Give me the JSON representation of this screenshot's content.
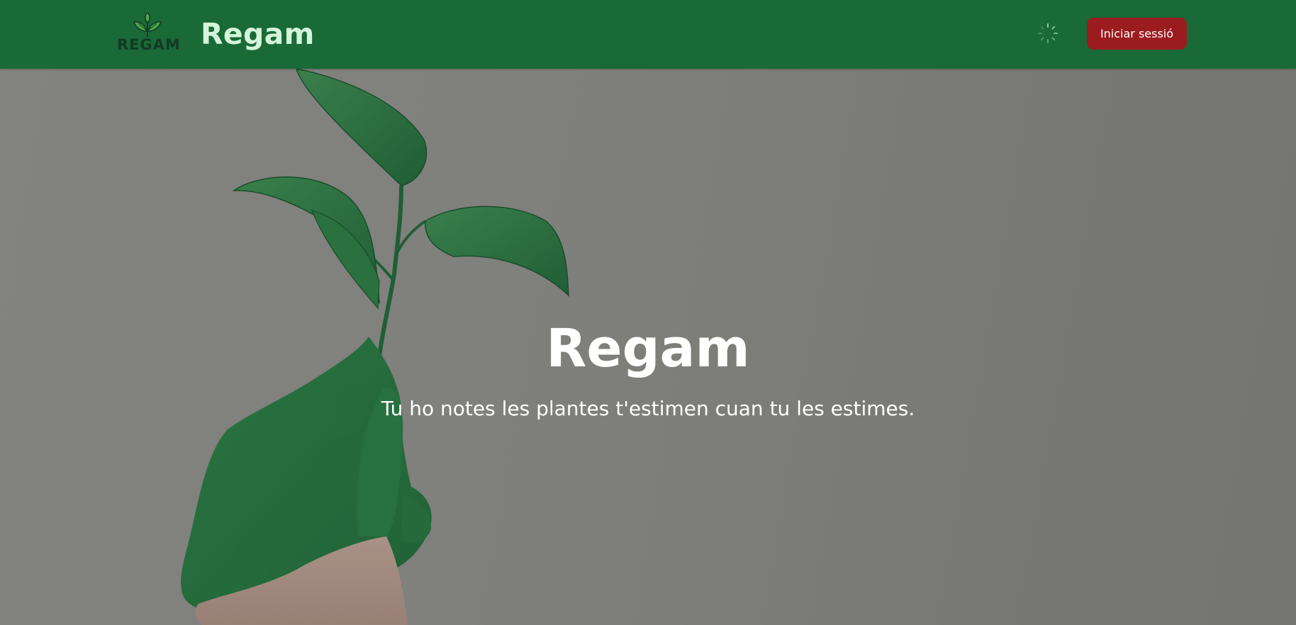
{
  "navbar": {
    "logo": {
      "icon": "sprout-leaves-icon",
      "text": "REGAM"
    },
    "brand_name": "Regam",
    "spinner_icon": "loading-spinner-icon",
    "login_label": "Iniciar sessió",
    "background_color": "#196a37",
    "login_color": "#9b1c1f"
  },
  "hero": {
    "title": "Regam",
    "subtitle": "Tu ho notes les plantes t'estimen cuan tu les estimes.",
    "image": "green-painted-hand-holding-plant-sprig"
  }
}
